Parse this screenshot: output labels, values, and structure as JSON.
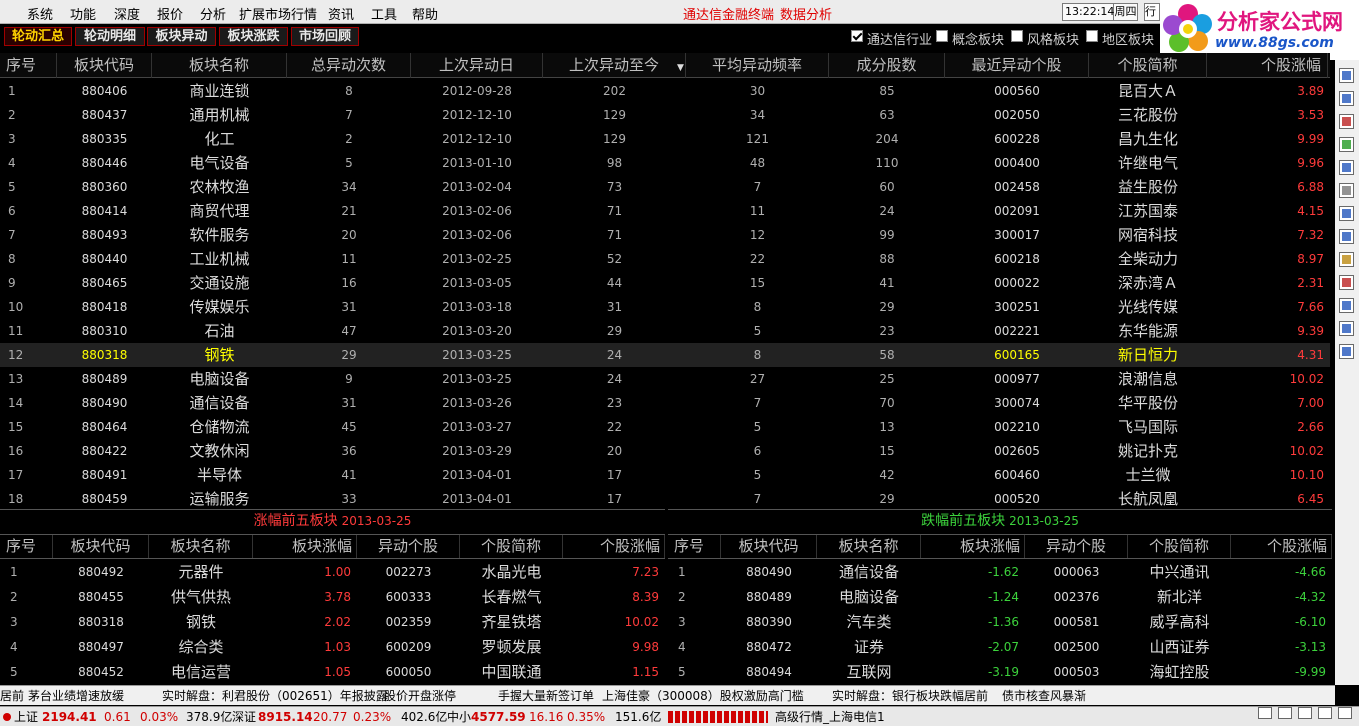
{
  "menu": [
    "系统",
    "功能",
    "深度",
    "报价",
    "分析",
    "扩展市场行情",
    "资讯",
    "工具",
    "帮助"
  ],
  "terminal_title": "通达信金融终端",
  "data_analysis": "数据分析",
  "clock": "13:22:14",
  "weekday": "周四",
  "quote_box": "行",
  "logo": {
    "title": "分析家公式网",
    "url": "www.88gs.com"
  },
  "tabs": [
    "轮动汇总",
    "轮动明细",
    "板块异动",
    "板块涨跌",
    "市场回顾"
  ],
  "checkboxes": [
    {
      "label": "通达信行业",
      "checked": true
    },
    {
      "label": "概念板块",
      "checked": false
    },
    {
      "label": "风格板块",
      "checked": false
    },
    {
      "label": "地区板块",
      "checked": false
    }
  ],
  "main_headers": [
    "序号",
    "板块代码",
    "板块名称",
    "总异动次数",
    "上次异动日",
    "上次异动至今",
    "平均异动频率",
    "成分股数",
    "最近异动个股",
    "个股简称",
    "个股涨幅"
  ],
  "sort_marker": "▼",
  "main_rows": [
    [
      "1",
      "880406",
      "商业连锁",
      "8",
      "2012-09-28",
      "202",
      "30",
      "85",
      "000560",
      "昆百大Ａ",
      "3.89"
    ],
    [
      "2",
      "880437",
      "通用机械",
      "7",
      "2012-12-10",
      "129",
      "34",
      "63",
      "002050",
      "三花股份",
      "3.53"
    ],
    [
      "3",
      "880335",
      "化工",
      "2",
      "2012-12-10",
      "129",
      "121",
      "204",
      "600228",
      "昌九生化",
      "9.99"
    ],
    [
      "4",
      "880446",
      "电气设备",
      "5",
      "2013-01-10",
      "98",
      "48",
      "110",
      "000400",
      "许继电气",
      "9.96"
    ],
    [
      "5",
      "880360",
      "农林牧渔",
      "34",
      "2013-02-04",
      "73",
      "7",
      "60",
      "002458",
      "益生股份",
      "6.88"
    ],
    [
      "6",
      "880414",
      "商贸代理",
      "21",
      "2013-02-06",
      "71",
      "11",
      "24",
      "002091",
      "江苏国泰",
      "4.15"
    ],
    [
      "7",
      "880493",
      "软件服务",
      "20",
      "2013-02-06",
      "71",
      "12",
      "99",
      "300017",
      "网宿科技",
      "7.32"
    ],
    [
      "8",
      "880440",
      "工业机械",
      "11",
      "2013-02-25",
      "52",
      "22",
      "88",
      "600218",
      "全柴动力",
      "8.97"
    ],
    [
      "9",
      "880465",
      "交通设施",
      "16",
      "2013-03-05",
      "44",
      "15",
      "41",
      "000022",
      "深赤湾Ａ",
      "2.31"
    ],
    [
      "10",
      "880418",
      "传媒娱乐",
      "31",
      "2013-03-18",
      "31",
      "8",
      "29",
      "300251",
      "光线传媒",
      "7.66"
    ],
    [
      "11",
      "880310",
      "石油",
      "47",
      "2013-03-20",
      "29",
      "5",
      "23",
      "002221",
      "东华能源",
      "9.39"
    ],
    [
      "12",
      "880318",
      "钢铁",
      "29",
      "2013-03-25",
      "24",
      "8",
      "58",
      "600165",
      "新日恒力",
      "4.31"
    ],
    [
      "13",
      "880489",
      "电脑设备",
      "9",
      "2013-03-25",
      "24",
      "27",
      "25",
      "000977",
      "浪潮信息",
      "10.02"
    ],
    [
      "14",
      "880490",
      "通信设备",
      "31",
      "2013-03-26",
      "23",
      "7",
      "70",
      "300074",
      "华平股份",
      "7.00"
    ],
    [
      "15",
      "880464",
      "仓储物流",
      "45",
      "2013-03-27",
      "22",
      "5",
      "13",
      "002210",
      "飞马国际",
      "2.66"
    ],
    [
      "16",
      "880422",
      "文教休闲",
      "36",
      "2013-03-29",
      "20",
      "6",
      "15",
      "002605",
      "姚记扑克",
      "10.02"
    ],
    [
      "17",
      "880491",
      "半导体",
      "41",
      "2013-04-01",
      "17",
      "5",
      "42",
      "600460",
      "士兰微",
      "10.10"
    ],
    [
      "18",
      "880459",
      "运输服务",
      "33",
      "2013-04-01",
      "17",
      "7",
      "29",
      "000520",
      "长航凤凰",
      "6.45"
    ]
  ],
  "selected_row": 11,
  "up_panel": {
    "title": "涨幅前五板块",
    "date": "2013-03-25",
    "headers": [
      "序号",
      "板块代码",
      "板块名称",
      "板块涨幅",
      "异动个股",
      "个股简称",
      "个股涨幅"
    ],
    "rows": [
      [
        "1",
        "880492",
        "元器件",
        "1.00",
        "002273",
        "水晶光电",
        "7.23"
      ],
      [
        "2",
        "880455",
        "供气供热",
        "3.78",
        "600333",
        "长春燃气",
        "8.39"
      ],
      [
        "3",
        "880318",
        "钢铁",
        "2.02",
        "002359",
        "齐星铁塔",
        "10.02"
      ],
      [
        "4",
        "880497",
        "综合类",
        "1.03",
        "600209",
        "罗顿发展",
        "9.98"
      ],
      [
        "5",
        "880452",
        "电信运营",
        "1.05",
        "600050",
        "中国联通",
        "1.15"
      ]
    ]
  },
  "down_panel": {
    "title": "跌幅前五板块",
    "date": "2013-03-25",
    "headers": [
      "序号",
      "板块代码",
      "板块名称",
      "板块涨幅",
      "异动个股",
      "个股简称",
      "个股涨幅"
    ],
    "rows": [
      [
        "1",
        "880490",
        "通信设备",
        "-1.62",
        "000063",
        "中兴通讯",
        "-4.66"
      ],
      [
        "2",
        "880489",
        "电脑设备",
        "-1.24",
        "002376",
        "新北洋",
        "-4.32"
      ],
      [
        "3",
        "880390",
        "汽车类",
        "-1.36",
        "000581",
        "威孚高科",
        "-6.10"
      ],
      [
        "4",
        "880472",
        "证券",
        "-2.07",
        "002500",
        "山西证券",
        "-3.13"
      ],
      [
        "5",
        "880494",
        "互联网",
        "-3.19",
        "000503",
        "海虹控股",
        "-9.99"
      ]
    ]
  },
  "ticker": [
    "居前",
    "茅台业绩增速放缓",
    "实时解盘：利君股份（002651）年报披露",
    "股价开盘涨停",
    "手握大量新签订单",
    "上海佳豪（300008）股权激励高门槛",
    "实时解盘：银行板块跌幅居前",
    "债市核查风暴渐"
  ],
  "status": {
    "sh_name": "上证",
    "sh_value": "2194.41",
    "sh_change": "0.61",
    "sh_pct": "0.03%",
    "sh_amount": "378.9亿",
    "sz_name": "深证",
    "sz_value": "8915.14",
    "sz_change": "20.77",
    "sz_pct": "0.23%",
    "sz_amount": "402.6亿",
    "zx_name": "中小",
    "zx_value": "4577.59",
    "zx_change": "16.16",
    "zx_pct": "0.35%",
    "zx_amount": "151.6亿",
    "feed": "高级行情_上海电信1"
  },
  "colors": {
    "up": "#ff3b3b",
    "down": "#3cd23c",
    "accent": "#ffd200",
    "title_red": "#e00000",
    "panel_title_up": "#ff3b3b",
    "panel_title_down": "#3cd23c"
  }
}
